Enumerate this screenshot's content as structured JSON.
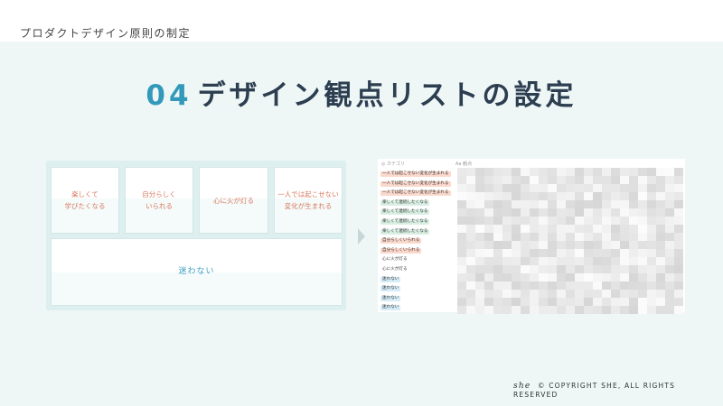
{
  "header": {
    "breadcrumb": "プロダクトデザイン原則の制定"
  },
  "title": {
    "number": "04",
    "text": "デザイン観点リストの設定"
  },
  "cards": [
    {
      "label": "楽しくて\n学びたくなる"
    },
    {
      "label": "自分らしく\nいられる"
    },
    {
      "label": "心に火が灯る"
    },
    {
      "label": "一人では起こせない\n変化が生まれる"
    },
    {
      "label": "迷わない"
    }
  ],
  "table": {
    "columns": [
      "カテゴリ",
      "観点"
    ],
    "rows": [
      {
        "category": "一人では起こせない変化が生まれる",
        "color": "orange"
      },
      {
        "category": "一人では起こせない変化が生まれる",
        "color": "orange"
      },
      {
        "category": "一人では起こせない変化が生まれる",
        "color": "orange"
      },
      {
        "category": "楽しくて連続したくなる",
        "color": "green"
      },
      {
        "category": "楽しくて連続したくなる",
        "color": "green"
      },
      {
        "category": "楽しくて連続したくなる",
        "color": "green"
      },
      {
        "category": "楽しくて連続したくなる",
        "color": "green"
      },
      {
        "category": "自分らしくいられる",
        "color": "orange"
      },
      {
        "category": "自分らしくいられる",
        "color": "orange"
      },
      {
        "category": "心に火が灯る",
        "color": "plain"
      },
      {
        "category": "心に火が灯る",
        "color": "plain"
      },
      {
        "category": "迷わない",
        "color": "blue"
      },
      {
        "category": "迷わない",
        "color": "blue"
      },
      {
        "category": "迷わない",
        "color": "blue"
      },
      {
        "category": "迷わない",
        "color": "blue"
      }
    ]
  },
  "footer": {
    "logo": "she",
    "copyright": "© COPYRIGHT SHE, ALL RIGHTS RESERVED"
  },
  "colors": {
    "accent": "#3399bb",
    "card_text": "#d9785e",
    "background": "#eef7f6"
  }
}
